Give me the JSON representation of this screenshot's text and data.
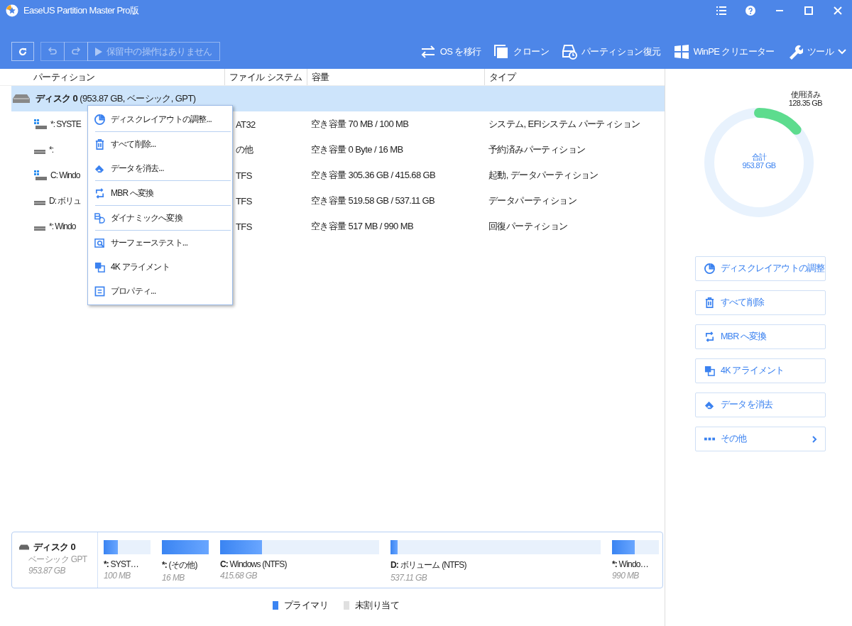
{
  "window": {
    "title": "EaseUS Partition Master Pro版"
  },
  "toolbar": {
    "buttons": [
      {
        "kind": "refresh",
        "disabled": false
      },
      {
        "kind": "undo",
        "disabled": true
      },
      {
        "kind": "redo",
        "disabled": true
      }
    ],
    "apply": {
      "label": "保留中の操作はありません",
      "disabled": true
    },
    "actions": [
      {
        "kind": "migrate",
        "label": "OS を移行"
      },
      {
        "kind": "clone",
        "label": "クローン"
      },
      {
        "kind": "recover",
        "label": "パーティション復元"
      },
      {
        "kind": "winpe",
        "label": "WinPE クリエーター"
      },
      {
        "kind": "tools",
        "label": "ツール"
      }
    ]
  },
  "table": {
    "columns": [
      "パーティション",
      "ファイル システム",
      "容量",
      "タイプ"
    ],
    "disk": {
      "name": "ディスク 0",
      "info": "(953.87 GB, ベーシック, GPT)",
      "selected": true
    },
    "rows": [
      {
        "kind": "system",
        "name": "*: SYSTE",
        "fs": "AT32",
        "capacity": "空き容量 70 MB / 100 MB",
        "type": "システム, EFIシステム パーティション"
      },
      {
        "kind": "plain",
        "name": "*:",
        "fs": "の他",
        "capacity": "空き容量 0 Byte / 16 MB",
        "type": "予約済みパーティション"
      },
      {
        "kind": "system",
        "name": "C: Windo",
        "fs": "TFS",
        "capacity": "空き容量 305.36 GB / 415.68 GB",
        "type": "起動, データパーティション"
      },
      {
        "kind": "plain",
        "name": "D: ボリュ",
        "fs": "TFS",
        "capacity": "空き容量 519.58 GB / 537.11 GB",
        "type": "データパーティション"
      },
      {
        "kind": "plain",
        "name": "*: Windo",
        "fs": "TFS",
        "capacity": "空き容量 517 MB / 990 MB",
        "type": "回復パーティション"
      }
    ]
  },
  "context_menu": [
    {
      "kind": "layout",
      "label": "ディスクレイアウトの調整...",
      "separator": true
    },
    {
      "kind": "delete",
      "label": "すべて削除...",
      "separator": false
    },
    {
      "kind": "wipe",
      "label": "データを消去...",
      "separator": true
    },
    {
      "kind": "convert",
      "label": "MBR へ変換",
      "separator": true
    },
    {
      "kind": "dynamic",
      "label": "ダイナミックへ変換",
      "separator": true
    },
    {
      "kind": "surface",
      "label": "サーフェーステスト...",
      "separator": false
    },
    {
      "kind": "align",
      "label": "4K アライメント",
      "separator": false
    },
    {
      "kind": "props",
      "label": "プロパティ...",
      "separator": false
    }
  ],
  "usage": {
    "used_label": "使用済み",
    "used_value": "128.35 GB",
    "total_label": "合計",
    "total_value": "953.87 GB",
    "level": 0.135
  },
  "side_actions": [
    {
      "kind": "layout",
      "label": "ディスクレイアウトの調整",
      "submenu": false
    },
    {
      "kind": "delete",
      "label": "すべて削除",
      "submenu": false
    },
    {
      "kind": "convert",
      "label": "MBR へ変換",
      "submenu": false
    },
    {
      "kind": "align",
      "label": "4K アライメント",
      "submenu": false
    },
    {
      "kind": "wipe",
      "label": "データを消去",
      "submenu": false
    },
    {
      "kind": "more",
      "label": "その他",
      "submenu": true
    }
  ],
  "disk_map": {
    "name": "ディスク 0",
    "type": "ベーシック GPT",
    "size": "953.87 GB",
    "partitions": [
      {
        "letter": "*:",
        "label": " SYST…",
        "size": "100 MB",
        "level": 0.3
      },
      {
        "letter": "*:",
        "label": " (その他)",
        "size": "16 MB",
        "level": 1.0
      },
      {
        "letter": "C:",
        "label": " Windows (NTFS)",
        "size": "415.68 GB",
        "level": 0.265
      },
      {
        "letter": "D:",
        "label": " ボリューム (NTFS)",
        "size": "537.11 GB",
        "level": 0.033
      },
      {
        "letter": "*:",
        "label": " Windo…",
        "size": "990 MB",
        "level": 0.478
      }
    ]
  },
  "legend": [
    {
      "kind": "primary",
      "label": "プライマリ"
    },
    {
      "kind": "unallocated",
      "label": "未割り当て"
    }
  ]
}
